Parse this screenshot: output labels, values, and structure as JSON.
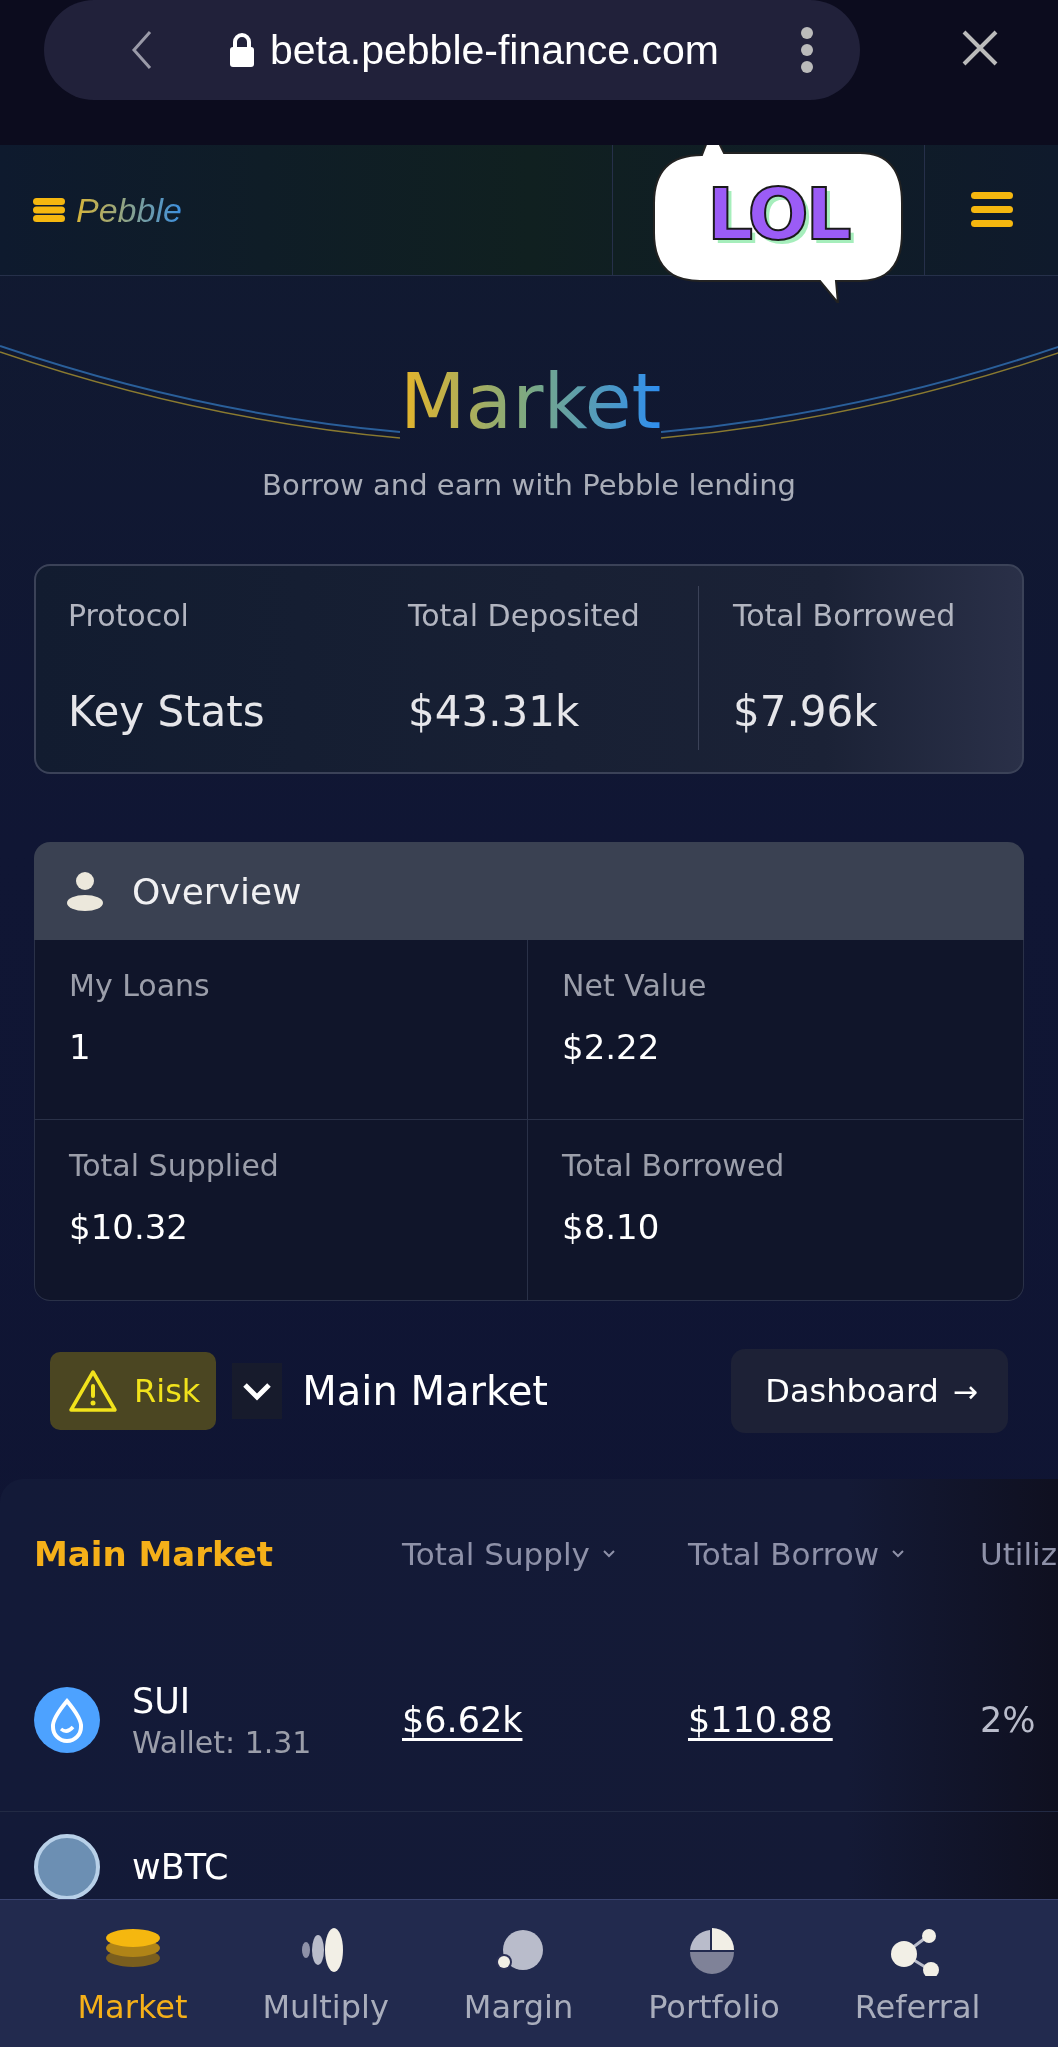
{
  "browser": {
    "url": "beta.pebble-finance.com"
  },
  "header": {
    "brand": "Pebble"
  },
  "sticker": {
    "text": "LOL"
  },
  "hero": {
    "title": "Market",
    "subtitle": "Borrow and earn with Pebble lending"
  },
  "protocol_stats": {
    "label": "Protocol",
    "heading": "Key Stats",
    "stats": [
      {
        "label": "Total Deposited",
        "value": "$43.31k"
      },
      {
        "label": "Total Borrowed",
        "value": "$7.96k"
      }
    ]
  },
  "overview": {
    "title": "Overview",
    "cells": [
      {
        "label": "My Loans",
        "value": "1"
      },
      {
        "label": "Net Value",
        "value": "$2.22"
      },
      {
        "label": "Total Supplied",
        "value": "$10.32"
      },
      {
        "label": "Total Borrowed",
        "value": "$8.10"
      }
    ]
  },
  "controls": {
    "risk": "Risk",
    "market_selector": {
      "label": "Main Market",
      "expanded": false
    },
    "dashboard": "Dashboard",
    "dashboard_arrow": "→"
  },
  "market_table": {
    "title": "Main Market",
    "columns": [
      {
        "label": "Total Supply",
        "sortable": true
      },
      {
        "label": "Total Borrow",
        "sortable": true
      },
      {
        "label": "Utiliz"
      }
    ],
    "rows": [
      {
        "asset": "SUI",
        "wallet": "Wallet: 1.31",
        "supply": "$6.62k",
        "borrow": "$110.88",
        "utilization": "2%"
      },
      {
        "asset": "wBTC"
      }
    ]
  },
  "bottom_nav": [
    {
      "label": "Market",
      "kind": "coins",
      "selected": true
    },
    {
      "label": "Multiply",
      "kind": "bars",
      "selected": false
    },
    {
      "label": "Margin",
      "kind": "circles",
      "selected": false
    },
    {
      "label": "Portfolio",
      "kind": "pie",
      "selected": false
    },
    {
      "label": "Referral",
      "kind": "share",
      "selected": false
    }
  ]
}
